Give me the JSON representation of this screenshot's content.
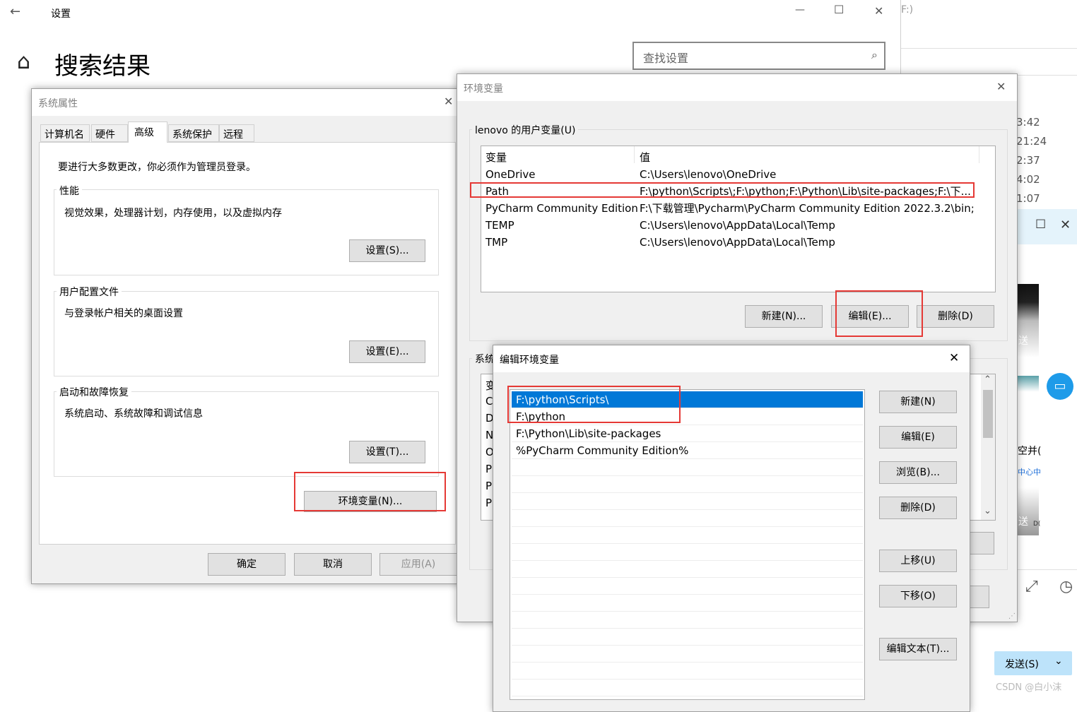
{
  "settings": {
    "back_glyph": "←",
    "title": "设置",
    "min_glyph": "—",
    "max_glyph": "☐",
    "close_glyph": "✕",
    "home_glyph": "⌂",
    "heading": "搜索结果",
    "search_placeholder": "查找设置"
  },
  "background": {
    "fragment_top": "F:)",
    "times": [
      "3:42",
      "21:24",
      "2:37",
      "4:02",
      "1:07"
    ],
    "send_fragment": "送",
    "send_fragment2": "送",
    "frag_text1": "空并(",
    "frag_text2": "中心中",
    "send_button": "发送(S)",
    "watermark": "CSDN @白小沫",
    "small_frag": "D("
  },
  "sysprops": {
    "title": "系统属性",
    "tabs": [
      "计算机名",
      "硬件",
      "高级",
      "系统保护",
      "远程"
    ],
    "admin_note": "要进行大多数更改，你必须作为管理员登录。",
    "perf": {
      "label": "性能",
      "desc": "视觉效果，处理器计划，内存使用，以及虚拟内存",
      "button": "设置(S)..."
    },
    "profile": {
      "label": "用户配置文件",
      "desc": "与登录帐户相关的桌面设置",
      "button": "设置(E)..."
    },
    "startup": {
      "label": "启动和故障恢复",
      "desc": "系统启动、系统故障和调试信息",
      "button": "设置(T)..."
    },
    "env_button": "环境变量(N)...",
    "ok": "确定",
    "cancel": "取消",
    "apply": "应用(A)"
  },
  "envvars": {
    "title": "环境变量",
    "user_group": "lenovo 的用户变量(U)",
    "col_var": "变量",
    "col_val": "值",
    "rows": [
      {
        "name": "OneDrive",
        "value": "C:\\Users\\lenovo\\OneDrive"
      },
      {
        "name": "Path",
        "value": "F:\\python\\Scripts\\;F:\\python;F:\\Python\\Lib\\site-packages;F:\\下..."
      },
      {
        "name": "PyCharm Community Edition",
        "value": "F:\\下载管理\\Pycharm\\PyCharm Community Edition 2022.3.2\\bin;"
      },
      {
        "name": "TEMP",
        "value": "C:\\Users\\lenovo\\AppData\\Local\\Temp"
      },
      {
        "name": "TMP",
        "value": "C:\\Users\\lenovo\\AppData\\Local\\Temp"
      }
    ],
    "new_btn": "新建(N)...",
    "edit_btn": "编辑(E)...",
    "del_btn": "删除(D)",
    "sys_group_partial": "系统",
    "sys_col_partial": "变",
    "sys_letters": [
      "C",
      "D",
      "N",
      "O",
      "P",
      "P",
      "P"
    ]
  },
  "editenv": {
    "title": "编辑环境变量",
    "entries": [
      "F:\\python\\Scripts\\",
      "F:\\python",
      "F:\\Python\\Lib\\site-packages",
      "%PyCharm Community Edition%"
    ],
    "new": "新建(N)",
    "edit": "编辑(E)",
    "browse": "浏览(B)...",
    "delete": "删除(D)",
    "up": "上移(U)",
    "down": "下移(O)",
    "edit_text": "编辑文本(T)..."
  }
}
